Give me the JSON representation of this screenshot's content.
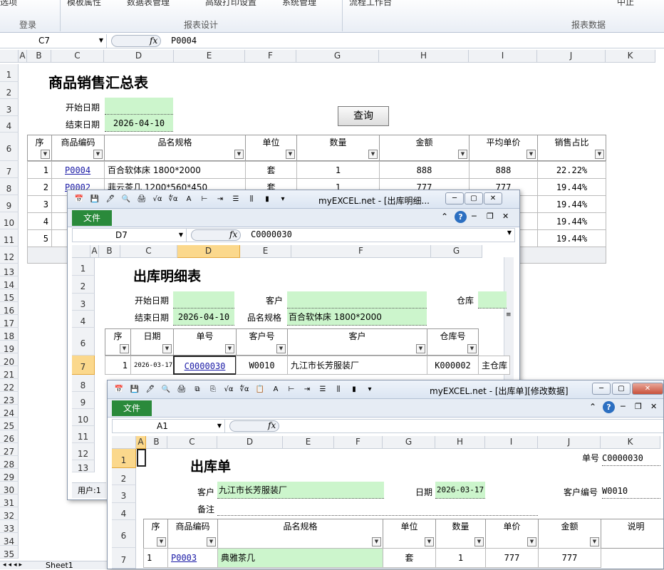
{
  "ribbon": {
    "tab_left": "选项",
    "btn1": "模板属性",
    "btn2": "数据表管理",
    "btn3": "高级打印设置",
    "btn4": "系统管理",
    "btn5": "流程工作台",
    "btn6": "中止",
    "groups": [
      "登录",
      "报表设计",
      "报表数据"
    ]
  },
  "main": {
    "namebox": "C7",
    "fx": "fx",
    "formula": "P0004",
    "columns": [
      "A",
      "B",
      "C",
      "D",
      "E",
      "F",
      "G",
      "H",
      "I",
      "J",
      "K"
    ],
    "rows": [
      "1",
      "2",
      "3",
      "4",
      "6",
      "7",
      "8",
      "9",
      "10",
      "11",
      "12",
      "13",
      "14",
      "15",
      "16",
      "17",
      "18",
      "19",
      "20",
      "21",
      "22",
      "23",
      "24",
      "25",
      "26",
      "27",
      "28",
      "29",
      "30",
      "31",
      "32",
      "33",
      "34",
      "35"
    ],
    "title": "商品销售汇总表",
    "start_label": "开始日期",
    "end_label": "结束日期",
    "end_value": "2026-04-10",
    "query": "查询",
    "headers": [
      "序",
      "商品编码",
      "品名规格",
      "单位",
      "数量",
      "金额",
      "平均单价",
      "销售占比"
    ],
    "table": [
      {
        "seq": "1",
        "code": "P0004",
        "name": "百合软体床 1800*2000",
        "unit": "套",
        "qty": "1",
        "amount": "888",
        "avg": "888",
        "share": "22.22%"
      },
      {
        "seq": "2",
        "code": "P0002",
        "name": "菲云茶几 1200*560*450",
        "unit": "套",
        "qty": "1",
        "amount": "777",
        "avg": "777",
        "share": "19.44%"
      },
      {
        "seq": "3",
        "code": "",
        "name": "",
        "unit": "",
        "qty": "",
        "amount": "",
        "avg": "",
        "share": "19.44%"
      },
      {
        "seq": "4",
        "code": "",
        "name": "",
        "unit": "",
        "qty": "",
        "amount": "",
        "avg": "",
        "share": "19.44%"
      },
      {
        "seq": "5",
        "code": "",
        "name": "",
        "unit": "",
        "qty": "",
        "amount": "",
        "avg": "",
        "share": "19.44%"
      }
    ],
    "sheet_tab": "Sheet1"
  },
  "win1": {
    "title": "myEXCEL.net - [出库明细...",
    "file": "文件",
    "namebox": "D7",
    "fx": "fx",
    "formula": "C0000030",
    "columns": [
      "A",
      "B",
      "C",
      "D",
      "E",
      "F",
      "G"
    ],
    "rows": [
      "1",
      "2",
      "3",
      "4",
      "6",
      "7",
      "8",
      "9",
      "10",
      "11",
      "12",
      "13"
    ],
    "heading": "出库明细表",
    "start_label": "开始日期",
    "end_label": "结束日期",
    "end_value": "2026-04-10",
    "customer_label": "客户",
    "product_label": "品名规格",
    "product_value": "百合软体床 1800*2000",
    "warehouse_label": "仓库",
    "headers": [
      "序",
      "日期",
      "单号",
      "客户号",
      "客户",
      "仓库号"
    ],
    "row": {
      "seq": "1",
      "date": "2026-03-17",
      "no": "C0000030",
      "cust_no": "W0010",
      "cust": "九江市长芳服装厂",
      "wh_no": "K000002",
      "wh": "主仓库"
    },
    "user": "用户:1"
  },
  "win2": {
    "title": "myEXCEL.net - [出库单][修改数据]",
    "file": "文件",
    "namebox": "A1",
    "fx": "fx",
    "formula": "",
    "columns": [
      "A",
      "B",
      "C",
      "D",
      "E",
      "F",
      "G",
      "H",
      "I",
      "J",
      "K"
    ],
    "rows": [
      "1",
      "2",
      "3",
      "4",
      "6",
      "7"
    ],
    "heading": "出库单",
    "no_label": "单号",
    "no_value": "C0000030",
    "customer_label": "客户",
    "customer_value": "九江市长芳服装厂",
    "date_label": "日期",
    "date_value": "2026-03-17",
    "cust_no_label": "客户编号",
    "cust_no_value": "W0010",
    "note_label": "备注",
    "headers": [
      "序",
      "商品编码",
      "品名规格",
      "单位",
      "数量",
      "单价",
      "金额",
      "说明"
    ],
    "row": {
      "seq": "1",
      "code": "P0003",
      "name": "典雅茶几",
      "unit": "套",
      "qty": "1",
      "price": "777",
      "amount": "777"
    }
  }
}
